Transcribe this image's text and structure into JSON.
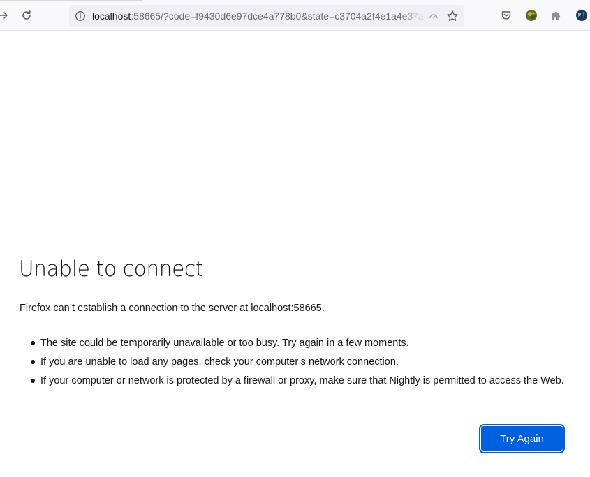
{
  "browser": {
    "url_host": "localhost",
    "url_rest": ":58665/?code=f9430d6e97dce4a778b0&state=c3704a2f4e1a4e37a",
    "icons": {
      "back": "back-arrow-icon",
      "forward": "forward-arrow-icon",
      "reload": "reload-icon",
      "site_info": "site-info-icon",
      "permissions": "permissions-icon",
      "bookmark": "bookmark-star-icon",
      "pocket": "pocket-icon",
      "profile": "profile-avatar-icon",
      "extensions": "extensions-puzzle-icon",
      "account": "account-globe-icon"
    },
    "colors": {
      "toolbar_bg": "#f9f9fb",
      "urlbar_bg": "#f0f0f4",
      "accent": "#0061e0"
    }
  },
  "error_page": {
    "title": "Unable to connect",
    "description": "Firefox can’t establish a connection to the server at localhost:58665.",
    "reasons": [
      "The site could be temporarily unavailable or too busy. Try again in a few moments.",
      "If you are unable to load any pages, check your computer’s network connection.",
      "If your computer or network is protected by a firewall or proxy, make sure that Nightly is permitted to access the Web."
    ],
    "try_again_label": "Try Again"
  }
}
